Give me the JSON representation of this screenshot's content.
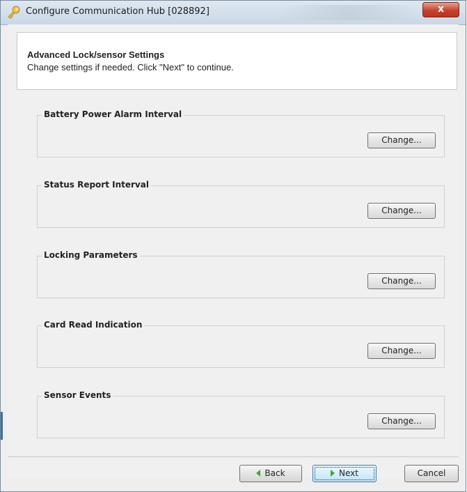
{
  "window": {
    "title": "Configure Communication Hub [028892]",
    "close_label": "x"
  },
  "header": {
    "title": "Advanced Lock/sensor Settings",
    "subtitle": "Change settings if needed. Click \"Next\" to continue."
  },
  "groups": [
    {
      "label": "Battery Power Alarm Interval",
      "button": "Change..."
    },
    {
      "label": "Status Report Interval",
      "button": "Change..."
    },
    {
      "label": "Locking Parameters",
      "button": "Change..."
    },
    {
      "label": "Card Read Indication",
      "button": "Change..."
    },
    {
      "label": "Sensor Events",
      "button": "Change..."
    }
  ],
  "footer": {
    "back_label": "Back",
    "next_label": "Next",
    "cancel_label": "Cancel"
  },
  "icons": {
    "window": "key-icon",
    "back": "arrow-left-icon",
    "next": "arrow-right-icon"
  },
  "colors": {
    "close_button": "#c5432e",
    "arrow": "#3fa63a",
    "next_highlight": "#bce4fa"
  }
}
